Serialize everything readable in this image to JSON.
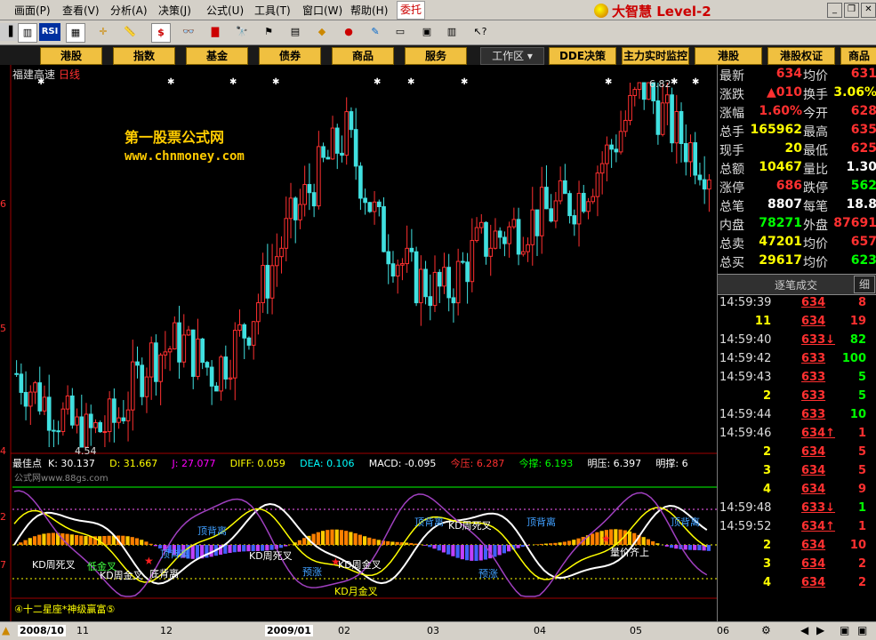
{
  "menu": [
    "画面(P)",
    "查看(V)",
    "分析(A)",
    "决策(J)",
    "公式(U)",
    "工具(T)",
    "窗口(W)",
    "帮助(H)"
  ],
  "menu_positions_hint": "",
  "wt_label": "委托",
  "brand": "大智慧 Level-2",
  "toolbar_text": {
    "rsi": "RSI",
    "dollar": "$"
  },
  "tabs": [
    "港股",
    "指数",
    "基金",
    "债券",
    "商品",
    "服务"
  ],
  "workspace_label": "工作区",
  "tabs_right": [
    "DDE决策",
    "主力实时监控",
    "港股",
    "港股权证",
    "商品"
  ],
  "stock": {
    "name": "福建高速",
    "period": "日线"
  },
  "watermark": {
    "title": "第一股票公式网",
    "url": "www.chnmoney.com"
  },
  "price_annotations": {
    "high": "6.82",
    "low": "4.54"
  },
  "axis_left_labels": [
    "6",
    "5",
    "4",
    "2",
    "7"
  ],
  "indicator_bar": [
    {
      "text": "最佳点",
      "color": "#ffffff"
    },
    {
      "text": "K: 30.137",
      "color": "#ffffff"
    },
    {
      "text": "D: 31.667",
      "color": "#ffff00"
    },
    {
      "text": "J: 27.077",
      "color": "#ff00ff"
    },
    {
      "text": "DIFF: 0.059",
      "color": "#ffff00"
    },
    {
      "text": "DEA: 0.106",
      "color": "#00ffff"
    },
    {
      "text": "MACD: -0.095",
      "color": "#ffffff"
    },
    {
      "text": "今压: 6.287",
      "color": "#ff3030"
    },
    {
      "text": "今撑: 6.193",
      "color": "#00ff00"
    },
    {
      "text": "明压: 6.397",
      "color": "#ffffff"
    },
    {
      "text": "明撑: 6",
      "color": "#ffffff"
    }
  ],
  "indicator_sublabel": "公式网www.88gs.com",
  "signals": [
    {
      "text": "顶背离",
      "color": "#40a0ff"
    },
    {
      "text": "KD周死叉",
      "color": "#ffffff"
    },
    {
      "text": "低金叉",
      "color": "#40ff40"
    },
    {
      "text": "KD周金叉",
      "color": "#ffffff"
    },
    {
      "text": "顶背离",
      "color": "#40a0ff"
    },
    {
      "text": "底背离",
      "color": "#ffffff"
    },
    {
      "text": "KD周死叉",
      "color": "#ffffff"
    },
    {
      "text": "预涨",
      "color": "#40a0ff"
    },
    {
      "text": "KD周金叉",
      "color": "#ffffff"
    },
    {
      "text": "顶背离",
      "color": "#40a0ff"
    },
    {
      "text": "KD周死叉",
      "color": "#ffffff"
    },
    {
      "text": "顶背离",
      "color": "#40a0ff"
    },
    {
      "text": "预涨",
      "color": "#40a0ff"
    },
    {
      "text": "量价齐上",
      "color": "#ffffff"
    },
    {
      "text": "顶背离",
      "color": "#40a0ff"
    },
    {
      "text": "KD月金叉",
      "color": "#ffff00"
    }
  ],
  "bottom_label": "④十二星座*神级赢富⑤",
  "date_labels": [
    "2008/10",
    "11",
    "12",
    "2009/01",
    "02",
    "03",
    "04",
    "05",
    "06"
  ],
  "quote": [
    {
      "l1": "最新",
      "v1": "634",
      "c1": "red",
      "l2": "均价",
      "v2": "631",
      "c2": "red"
    },
    {
      "l1": "涨跌",
      "v1": "▲010",
      "c1": "red",
      "l2": "换手",
      "v2": "3.06%",
      "c2": "yellow"
    },
    {
      "l1": "涨幅",
      "v1": "1.60%",
      "c1": "red",
      "l2": "今开",
      "v2": "628",
      "c2": "red"
    },
    {
      "l1": "总手",
      "v1": "165962",
      "c1": "yellow",
      "l2": "最高",
      "v2": "635",
      "c2": "red"
    },
    {
      "l1": "现手",
      "v1": "20",
      "c1": "yellow",
      "l2": "最低",
      "v2": "625",
      "c2": "red"
    },
    {
      "l1": "总额",
      "v1": "10467",
      "c1": "yellow",
      "l2": "量比",
      "v2": "1.30",
      "c2": "white"
    },
    {
      "l1": "涨停",
      "v1": "686",
      "c1": "red",
      "l2": "跌停",
      "v2": "562",
      "c2": "green"
    },
    {
      "l1": "总笔",
      "v1": "8807",
      "c1": "white",
      "l2": "每笔",
      "v2": "18.8",
      "c2": "white"
    },
    {
      "l1": "内盘",
      "v1": "78271",
      "c1": "green",
      "l2": "外盘",
      "v2": "87691",
      "c2": "red"
    },
    {
      "l1": "总卖",
      "v1": "47201",
      "c1": "yellow",
      "l2": "均价",
      "v2": "657",
      "c2": "red"
    },
    {
      "l1": "总买",
      "v1": "29617",
      "c1": "yellow",
      "l2": "均价",
      "v2": "623",
      "c2": "green"
    }
  ],
  "tick_header": "逐笔成交",
  "tick_detail": "细",
  "ticks": [
    {
      "t": "14:59:39",
      "p": "634",
      "pc": "red",
      "v": "8",
      "vc": "red"
    },
    {
      "t": "",
      "p": "11",
      "pc": "yellow",
      "p2": "634",
      "v": "19",
      "vc": "red"
    },
    {
      "t": "14:59:40",
      "p": "633↓",
      "pc": "red",
      "v": "82",
      "vc": "green"
    },
    {
      "t": "14:59:42",
      "p": "633",
      "pc": "red",
      "v": "100",
      "vc": "green"
    },
    {
      "t": "14:59:43",
      "p": "633",
      "pc": "red",
      "v": "5",
      "vc": "green"
    },
    {
      "t": "",
      "p": "2",
      "pc": "yellow",
      "p2": "633",
      "v": "5",
      "vc": "green"
    },
    {
      "t": "14:59:44",
      "p": "633",
      "pc": "red",
      "v": "10",
      "vc": "green"
    },
    {
      "t": "14:59:46",
      "p": "634↑",
      "pc": "red",
      "v": "1",
      "vc": "red"
    },
    {
      "t": "",
      "p": "2",
      "pc": "yellow",
      "p2": "634",
      "v": "5",
      "vc": "red"
    },
    {
      "t": "",
      "p": "3",
      "pc": "yellow",
      "p2": "634",
      "v": "5",
      "vc": "red"
    },
    {
      "t": "",
      "p": "4",
      "pc": "yellow",
      "p2": "634",
      "v": "9",
      "vc": "red"
    },
    {
      "t": "14:59:48",
      "p": "633↓",
      "pc": "red",
      "v": "1",
      "vc": "green"
    },
    {
      "t": "14:59:52",
      "p": "634↑",
      "pc": "red",
      "v": "1",
      "vc": "red"
    },
    {
      "t": "",
      "p": "2",
      "pc": "yellow",
      "p2": "634",
      "v": "10",
      "vc": "red"
    },
    {
      "t": "",
      "p": "3",
      "pc": "yellow",
      "p2": "634",
      "v": "2",
      "vc": "red"
    },
    {
      "t": "",
      "p": "4",
      "pc": "yellow",
      "p2": "634",
      "v": "2",
      "vc": "red"
    }
  ],
  "colors": {
    "up": "#ff3030",
    "down": "#40e0e0",
    "bg": "#000000",
    "grid": "#800000"
  },
  "chart_data": {
    "type": "line",
    "title": "福建高速 日线",
    "ohlc_close_estimates": [
      5.0,
      4.8,
      4.6,
      4.7,
      5.1,
      5.2,
      5.0,
      5.3,
      5.8,
      6.2,
      6.5,
      5.9,
      5.6,
      5.5,
      5.8,
      5.9,
      6.0,
      6.1,
      6.4,
      6.8,
      6.5,
      6.3
    ],
    "high": 6.82,
    "low": 4.54
  }
}
